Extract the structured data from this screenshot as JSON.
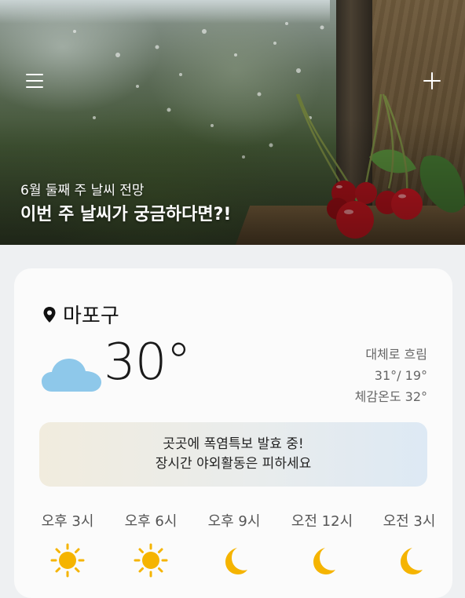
{
  "header": {
    "menu_icon": "menu-icon",
    "add_icon": "plus-icon"
  },
  "banner": {
    "subtitle": "6월 둘째 주 날씨 전망",
    "title": "이번 주 날씨가 궁금하다면?!"
  },
  "weather": {
    "location_icon": "location-pin-icon",
    "location": "마포구",
    "condition_icon": "cloud-icon",
    "temperature": "30°",
    "condition": "대체로 흐림",
    "high_low": "31°/ 19°",
    "feels_like": "체감온도 32°",
    "accent_cloud": "#8ec8ea"
  },
  "alert": {
    "line1": "곳곳에 폭염특보 발효 중!",
    "line2": "장시간 야외활동은 피하세요"
  },
  "hourly": [
    {
      "time": "오후 3시",
      "icon": "sun-icon"
    },
    {
      "time": "오후 6시",
      "icon": "sun-icon"
    },
    {
      "time": "오후 9시",
      "icon": "moon-icon"
    },
    {
      "time": "오전 12시",
      "icon": "moon-icon"
    },
    {
      "time": "오전 3시",
      "icon": "moon-icon"
    }
  ]
}
